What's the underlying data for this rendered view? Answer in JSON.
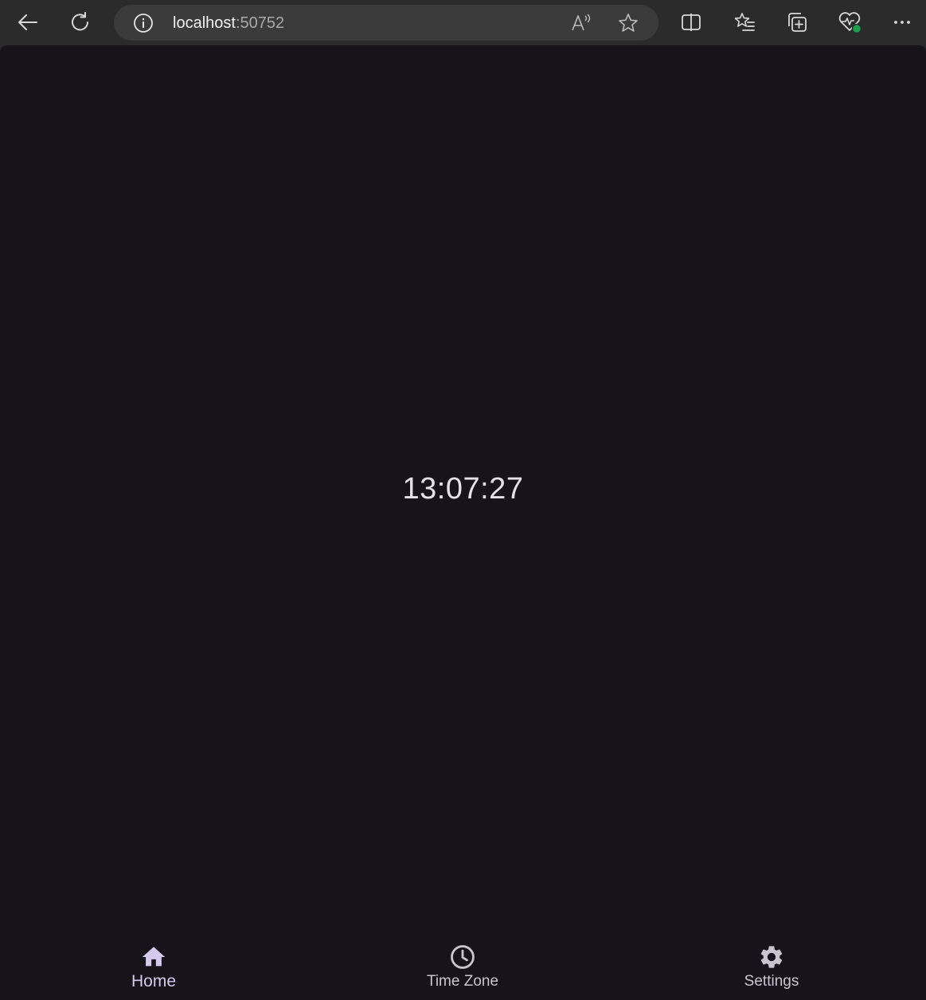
{
  "browser": {
    "url_host": "localhost",
    "url_port": ":50752",
    "icons": {
      "back": "back-arrow-icon",
      "refresh": "refresh-icon",
      "site_info": "info-icon",
      "read_aloud": "read-aloud-icon",
      "favorite": "star-icon",
      "split_screen": "split-screen-icon",
      "favorites": "favorites-list-icon",
      "collections": "collections-icon",
      "performance": "heart-pulse-icon",
      "more": "more-dots-icon"
    },
    "colors": {
      "toolbar": "#2b2b2b",
      "address_bar": "#3b3b3b",
      "status_dot": "#1aa34a"
    }
  },
  "app": {
    "clock_time": "13:07:27",
    "background_color": "#16131a",
    "nav": {
      "items": [
        {
          "label": "Home",
          "icon": "home-icon",
          "active": true
        },
        {
          "label": "Time Zone",
          "icon": "clock-icon",
          "active": false
        },
        {
          "label": "Settings",
          "icon": "gear-icon",
          "active": false
        }
      ]
    },
    "colors": {
      "active_nav": "#d6c9ee",
      "inactive_nav": "#cac4cf",
      "clock_text": "#e6e1e9"
    }
  }
}
